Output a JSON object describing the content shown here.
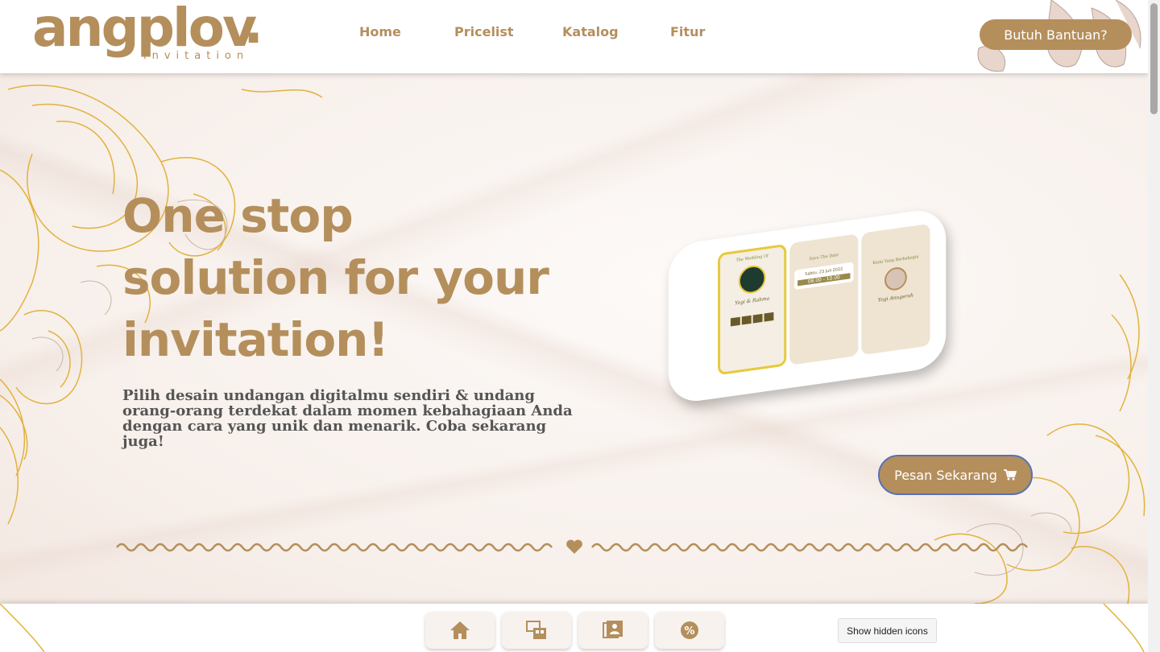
{
  "brand": {
    "name": "angplov",
    "dot": ".",
    "tagline": "invitation"
  },
  "nav": {
    "items": [
      {
        "label": "Home"
      },
      {
        "label": "Pricelist"
      },
      {
        "label": "Katalog"
      },
      {
        "label": "Fitur"
      }
    ],
    "help_button": "Butuh Bantuan?"
  },
  "hero": {
    "headline_lines": [
      "One stop",
      "solution for your",
      "invitation!"
    ],
    "subtext": "Pilih desain undangan digitalmu sendiri & undang orang-orang terdekat dalam momen kebahagiaan Anda dengan cara yang unik dan menarik. Coba sekarang juga!",
    "order_button": "Pesan Sekarang",
    "order_icon": "shopping-cart-icon"
  },
  "mockup": {
    "screen1_title": "The Wedding Of",
    "screen1_names": "Yogi & Rahma",
    "screen2_title": "Save The Date",
    "screen2_date": "Sabtu, 23 Juli 2022",
    "screen2_time": "08.00 - 10.00",
    "screen3_title": "Kami Yang Berbahagia",
    "screen3_name": "Yogi Anugerah"
  },
  "bottom_dock": {
    "items": [
      {
        "icon": "home-icon"
      },
      {
        "icon": "catalog-icon"
      },
      {
        "icon": "gallery-icon"
      },
      {
        "icon": "discount-icon"
      }
    ]
  },
  "system": {
    "hidden_icons_label": "Show hidden icons"
  },
  "colors": {
    "accent": "#b48f5c",
    "text": "#555555",
    "background": "#fbf6f3",
    "gold": "#e2b23c"
  }
}
